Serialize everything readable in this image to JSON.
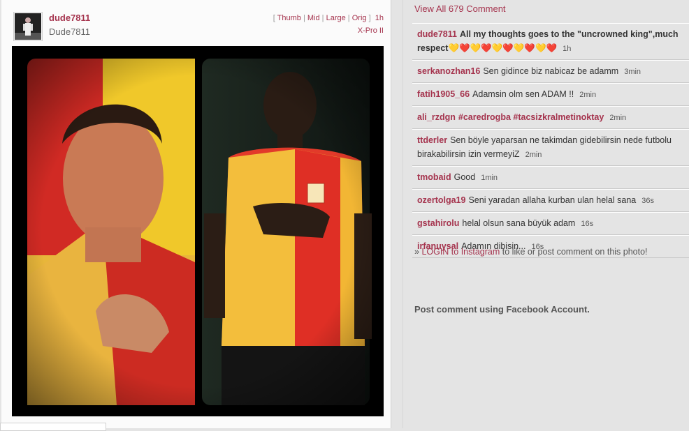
{
  "post": {
    "username": "dude7811",
    "full_name": "Dude7811",
    "sizes": {
      "open": "[",
      "thumb": "Thumb",
      "mid": "Mid",
      "large": "Large",
      "orig": "Orig",
      "close": "]",
      "age": "1h"
    },
    "filter": "X-Pro II"
  },
  "comments_header": "View All 679 Comment",
  "comments": [
    {
      "user": "dude7811",
      "text": "All my thoughts goes to the \"uncrowned king\",much respect💛❤️💛❤️💛❤️💛❤️💛❤️",
      "time": "1h"
    },
    {
      "user": "serkanozhan16",
      "text": "Sen gidince biz nabicaz be adamm",
      "time": "3min"
    },
    {
      "user": "fatih1905_66",
      "text": "Adamsin olm sen ADAM !!",
      "time": "2min"
    },
    {
      "user": "ali_rzdgn",
      "text": "#caredrogba #tacsizkralmetinoktay",
      "time": "2min"
    },
    {
      "user": "ttderler",
      "text": "Sen böyle yaparsan ne takimdan gidebilirsin nede futbolu birakabilirsin izin vermeyiZ",
      "time": "2min"
    },
    {
      "user": "tmobaid",
      "text": "Good",
      "time": "1min"
    },
    {
      "user": "ozertolga19",
      "text": "Seni yaradan allaha kurban ulan helal sana",
      "time": "36s"
    },
    {
      "user": "gstahirolu",
      "text": "helal olsun sana büyük adam",
      "time": "16s"
    },
    {
      "user": "irfanuysal",
      "text": "Adamın dibisin...",
      "time": "16s"
    }
  ],
  "login": {
    "prefix": "»",
    "link": "LOGIN to Instagram",
    "rest": "to like or post comment on this photo!"
  },
  "facebook_label": "Post comment using Facebook Account.",
  "colors": {
    "link": "#a5344e",
    "page_bg": "#e4e4e4",
    "card_bg": "#fbfbfb",
    "yellow": "#f2c230",
    "red": "#d0242b"
  }
}
